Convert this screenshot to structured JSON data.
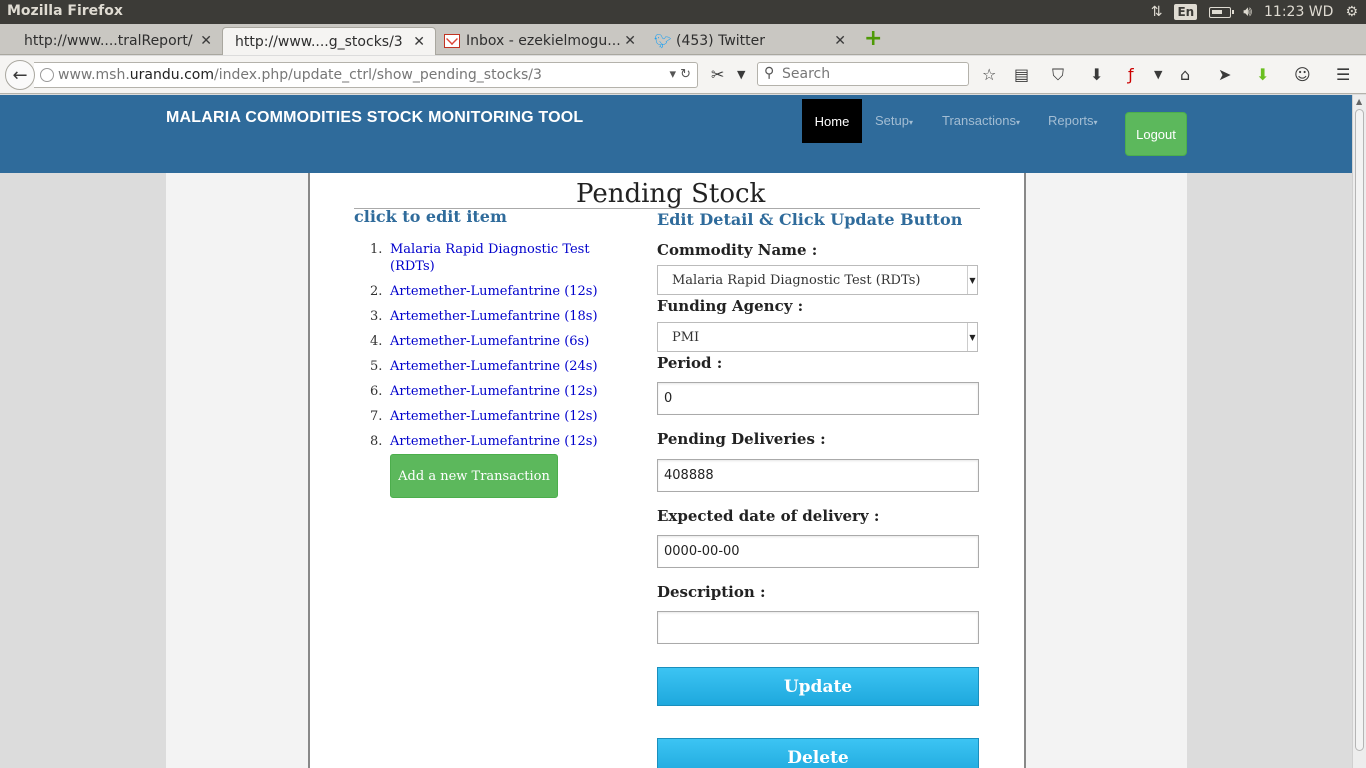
{
  "os": {
    "app_title": "Mozilla Firefox",
    "lang": "En",
    "clock": "11:23 WD"
  },
  "tabs": [
    {
      "label": "http://www....tralReport/"
    },
    {
      "label": "http://www....g_stocks/3"
    },
    {
      "label": "Inbox - ezekielmogu..."
    },
    {
      "label": "(453) Twitter"
    }
  ],
  "navbar": {
    "url_prefix": "www.msh.",
    "url_host": "urandu.com",
    "url_path": "/index.php/update_ctrl/show_pending_stocks/3",
    "search_placeholder": "Search"
  },
  "app": {
    "title": "MALARIA COMMODITIES STOCK MONITORING TOOL",
    "nav": {
      "home": "Home",
      "setup": "Setup",
      "transactions": "Transactions",
      "reports": "Reports",
      "logout": "Logout"
    }
  },
  "page": {
    "title": "Pending Stock",
    "left_heading": "click to edit item",
    "right_heading": "Edit Detail & Click Update Button",
    "items": [
      {
        "num": "1.",
        "label": "Malaria Rapid Diagnostic Test (RDTs)"
      },
      {
        "num": "2.",
        "label": "Artemether-Lumefantrine (12s)"
      },
      {
        "num": "3.",
        "label": "Artemether-Lumefantrine (18s)"
      },
      {
        "num": "4.",
        "label": "Artemether-Lumefantrine (6s)"
      },
      {
        "num": "5.",
        "label": "Artemether-Lumefantrine (24s)"
      },
      {
        "num": "6.",
        "label": "Artemether-Lumefantrine (12s)"
      },
      {
        "num": "7.",
        "label": "Artemether-Lumefantrine (12s)"
      },
      {
        "num": "8.",
        "label": "Artemether-Lumefantrine (12s)"
      }
    ],
    "add_button": "Add a new Transaction"
  },
  "form": {
    "commodity_label": "Commodity Name :",
    "commodity_value": "Malaria Rapid Diagnostic Test (RDTs)",
    "agency_label": "Funding Agency :",
    "agency_value": "PMI",
    "period_label": "Period :",
    "period_value": "0",
    "pending_label": "Pending Deliveries :",
    "pending_value": "408888",
    "expected_label": "Expected date of delivery :",
    "expected_value": "0000-00-00",
    "description_label": "Description :",
    "description_value": "",
    "update_button": "Update",
    "delete_button": "Delete"
  }
}
